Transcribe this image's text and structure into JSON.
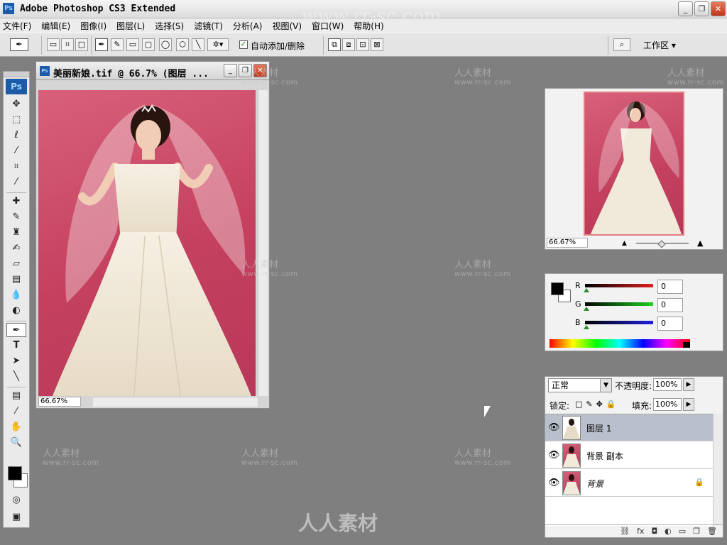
{
  "app": {
    "title": "Adobe Photoshop CS3 Extended",
    "logo": "Ps",
    "watermark_url": "www.rr-sc.com",
    "watermark_text": "人人素材"
  },
  "window_buttons": [
    "_",
    "❐",
    "✕"
  ],
  "menu": [
    "文件(F)",
    "编辑(E)",
    "图像(I)",
    "图层(L)",
    "选择(S)",
    "滤镜(T)",
    "分析(A)",
    "视图(V)",
    "窗口(W)",
    "帮助(H)"
  ],
  "options": {
    "auto_add_delete_checked": true,
    "auto_add_delete_label": "自动添加/删除",
    "workspace_label": "工作区 ▾"
  },
  "document": {
    "title": "美丽新娘.tif @ 66.7% (图层 ...",
    "zoom": "66.67%"
  },
  "navigator": {
    "zoom": "66.67%"
  },
  "color": {
    "r_label": "R",
    "g_label": "G",
    "b_label": "B",
    "r_value": "0",
    "g_value": "0",
    "b_value": "0",
    "r_bar": "#c0201e",
    "g_bar": "#20c020",
    "b_bar": "#2020c0"
  },
  "layers": {
    "blend_mode": "正常",
    "opacity_label": "不透明度:",
    "opacity_value": "100%",
    "lock_label": "锁定:",
    "fill_label": "填充:",
    "fill_value": "100%",
    "items": [
      {
        "name": "图层 1",
        "selected": true,
        "locked": false
      },
      {
        "name": "背景 副本",
        "selected": false,
        "locked": false
      },
      {
        "name": "背景",
        "selected": false,
        "locked": true
      }
    ],
    "footer_icons": [
      "link-icon",
      "fx-icon",
      "mask-icon",
      "adjustment-icon",
      "folder-icon",
      "new-layer-icon",
      "trash-icon"
    ]
  },
  "toolbox": {
    "tools": [
      "move-icon",
      "marquee-icon",
      "lasso-icon",
      "magic-wand-icon",
      "crop-icon",
      "eyedropper-icon",
      "healing-icon",
      "brush-icon",
      "stamp-icon",
      "history-brush-icon",
      "eraser-icon",
      "gradient-icon",
      "blur-icon",
      "dodge-icon",
      "pen-icon",
      "type-icon",
      "path-select-icon",
      "line-icon",
      "notes-icon",
      "eyedropper2-icon",
      "hand-icon",
      "zoom-icon"
    ]
  }
}
